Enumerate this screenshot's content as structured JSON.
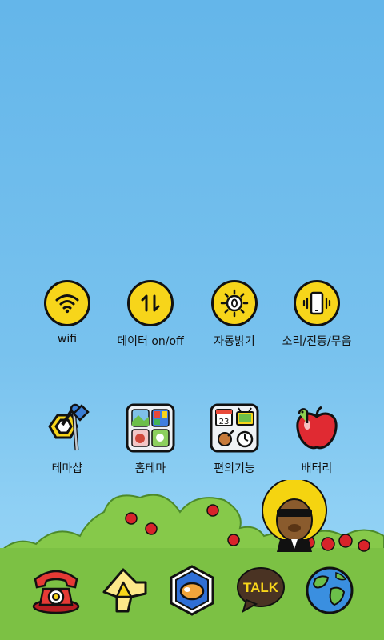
{
  "quick_settings": [
    {
      "label": "wifi",
      "icon": "wifi-icon"
    },
    {
      "label": "데이터 on/off",
      "icon": "data-toggle-icon"
    },
    {
      "label": "자동밝기",
      "icon": "auto-brightness-icon"
    },
    {
      "label": "소리/진동/무음",
      "icon": "sound-vibrate-mute-icon"
    }
  ],
  "apps": [
    {
      "label": "테마샵",
      "icon": "theme-shop-icon"
    },
    {
      "label": "홈테마",
      "icon": "home-theme-icon"
    },
    {
      "label": "편의기능",
      "icon": "convenience-icon"
    },
    {
      "label": "배터리",
      "icon": "battery-apple-icon"
    }
  ],
  "dock": [
    {
      "icon": "phone-icon"
    },
    {
      "icon": "messages-envelope-icon"
    },
    {
      "icon": "camera-icon"
    },
    {
      "icon": "talk-bubble-icon",
      "text": "TALK"
    },
    {
      "icon": "globe-icon"
    }
  ],
  "colors": {
    "sky_top": "#64b6ea",
    "sky_bottom": "#9ad6f6",
    "accent_yellow": "#f7d51a",
    "grass": "#7cc144",
    "outline": "#111111"
  }
}
